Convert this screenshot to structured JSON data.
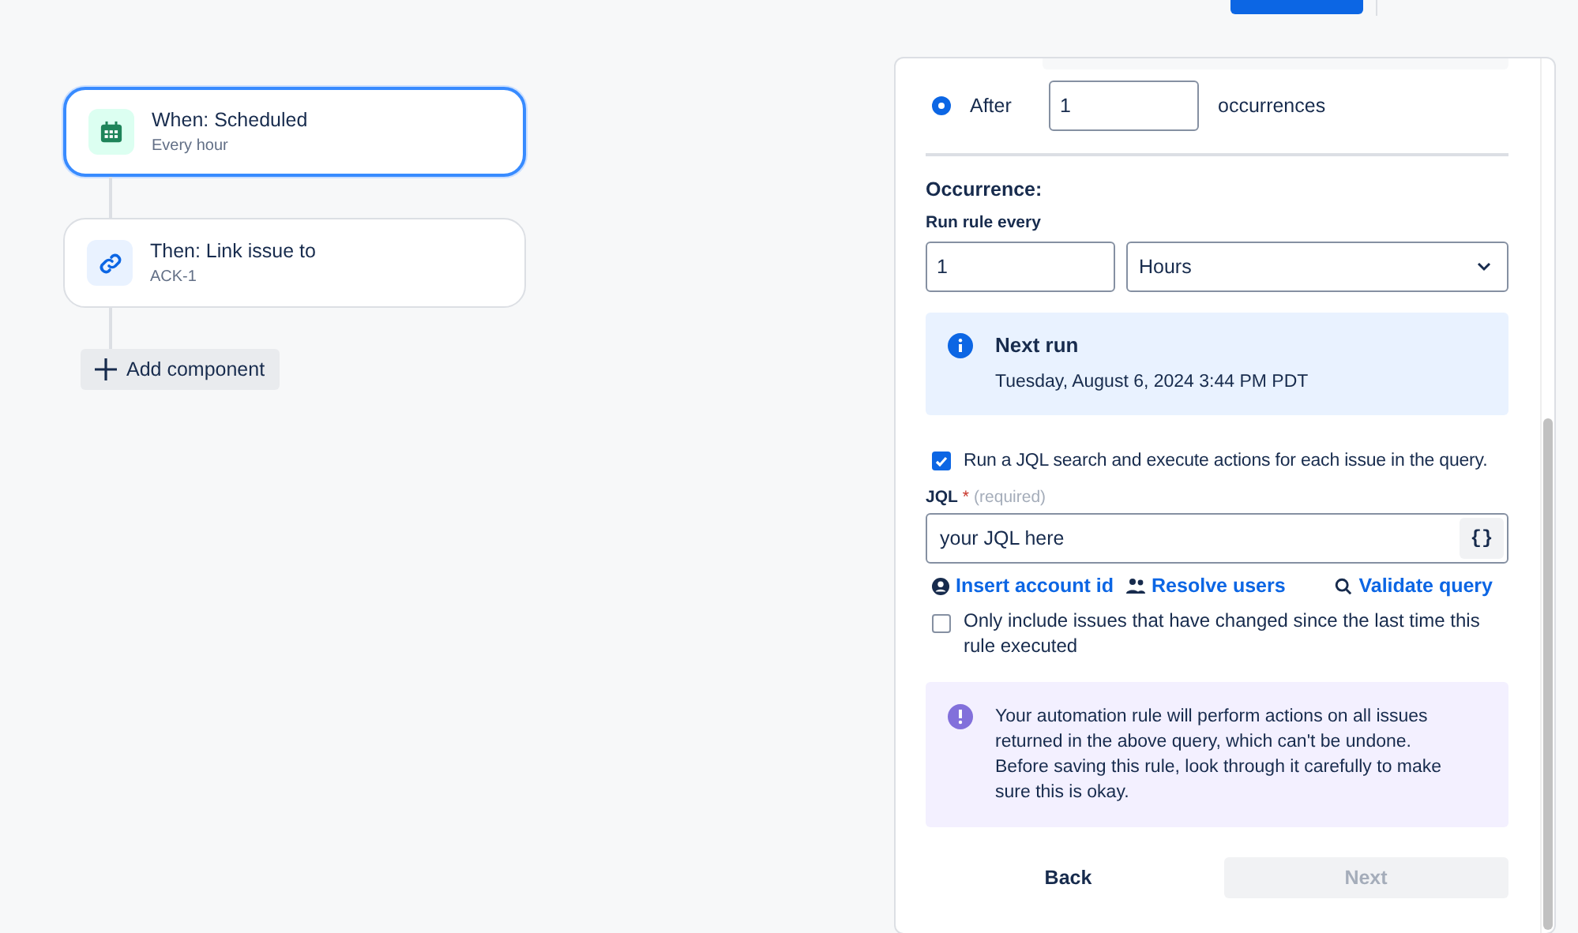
{
  "header": {
    "primary_button": {
      "kind": "primary"
    }
  },
  "flow": {
    "nodes": [
      {
        "title": "When: Scheduled",
        "subtitle": "Every hour",
        "kind": "trigger",
        "selected": true
      },
      {
        "title": "Then: Link issue to",
        "subtitle": "ACK-1",
        "kind": "action",
        "selected": false
      }
    ],
    "add_button": "Add component"
  },
  "panel": {
    "end_option": {
      "label": "After",
      "selected": true,
      "value": "1",
      "suffix": "occurrences"
    },
    "occurrence": {
      "heading": "Occurrence:",
      "label": "Run rule every",
      "value": "1",
      "unit": "Hours"
    },
    "next_run": {
      "title": "Next run",
      "value": "Tuesday, August 6, 2024 3:44 PM PDT"
    },
    "jql_search": {
      "label": "Run a JQL search and execute actions for each issue in the query.",
      "checked": true
    },
    "jql": {
      "label": "JQL",
      "required_mark": "*",
      "hint": "(required)",
      "value": "your JQL here",
      "format_button": "{}"
    },
    "links": [
      {
        "label": "Insert account id",
        "kind": "account"
      },
      {
        "label": "Resolve users",
        "kind": "users"
      },
      {
        "label": "Validate query",
        "kind": "search"
      }
    ],
    "changed_only": {
      "label": "Only include issues that have changed since the last time this rule executed",
      "checked": false
    },
    "warning": "Your automation rule will perform actions on all issues returned in the above query, which can't be undone. Before saving this rule, look through it carefully to make sure this is okay.",
    "buttons": [
      {
        "label": "Back",
        "disabled": false
      },
      {
        "label": "Next",
        "disabled": true
      }
    ]
  }
}
